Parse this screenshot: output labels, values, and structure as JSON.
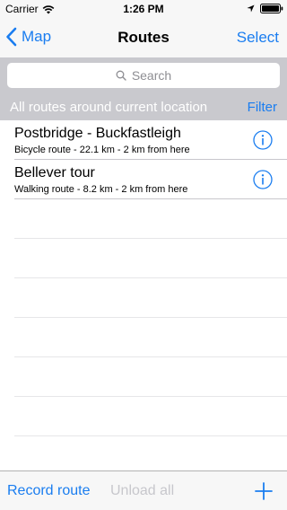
{
  "status_bar": {
    "carrier": "Carrier",
    "time": "1:26 PM",
    "icons": [
      "wifi-icon",
      "location-arrow-icon",
      "battery-icon"
    ]
  },
  "nav_bar": {
    "back_label": "Map",
    "title": "Routes",
    "select_label": "Select"
  },
  "search": {
    "placeholder": "Search"
  },
  "section": {
    "title": "All routes around current location",
    "filter_label": "Filter"
  },
  "routes": [
    {
      "name": "Postbridge - Buckfastleigh",
      "detail": "Bicycle route - 22.1 km - 2 km from here"
    },
    {
      "name": "Bellever tour",
      "detail": "Walking route - 8.2 km - 2 km from here"
    }
  ],
  "toolbar": {
    "record_label": "Record route",
    "unload_label": "Unload all"
  },
  "colors": {
    "accent": "#1a7df0",
    "bar_background": "#f7f7f7",
    "section_background": "#c9c9ce",
    "disabled_text": "#c7c7cc"
  }
}
